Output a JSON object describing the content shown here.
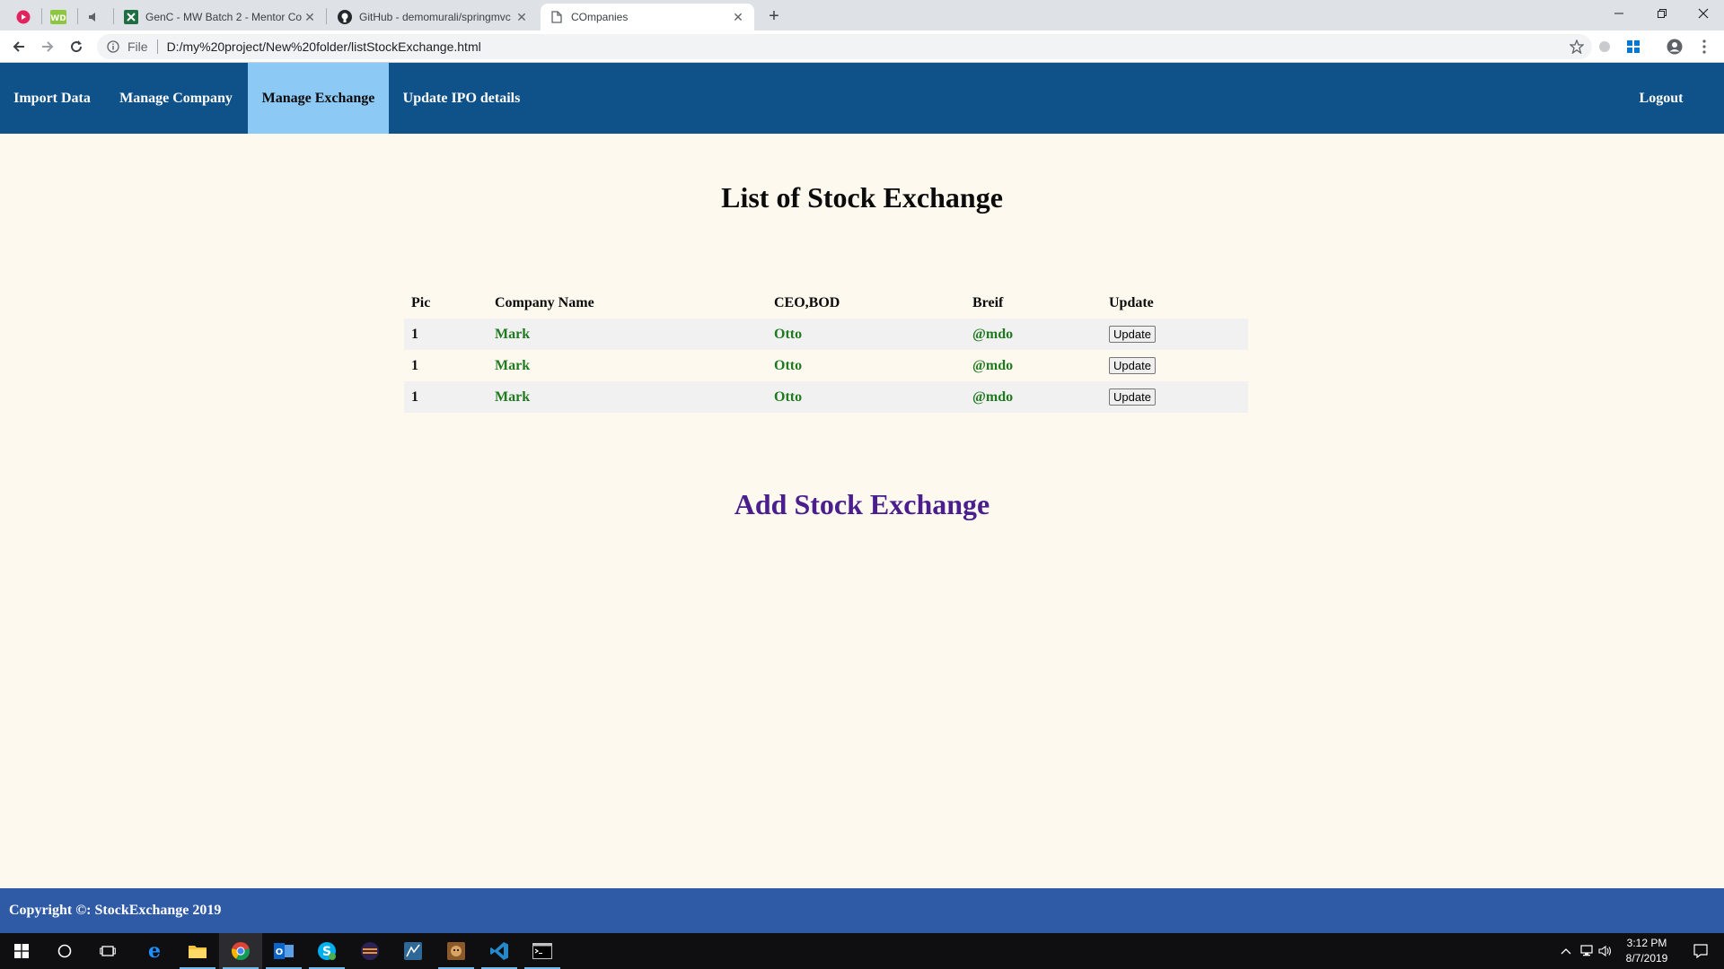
{
  "browser": {
    "tabs": [
      {
        "title": "GenC - MW Batch 2 - Mentor Co",
        "icon": "excel-icon"
      },
      {
        "title": "GitHub - demomurali/springmvc",
        "icon": "github-icon"
      },
      {
        "title": "COmpanies",
        "icon": "page-icon",
        "active": true
      }
    ],
    "address": {
      "scheme": "File",
      "url": "D:/my%20project/New%20folder/listStockExchange.html"
    }
  },
  "nav": {
    "items": [
      {
        "label": "Import Data"
      },
      {
        "label": "Manage Company"
      },
      {
        "label": "Manage Exchange",
        "active": true
      },
      {
        "label": "Update IPO details"
      }
    ],
    "logout_label": "Logout",
    "colors": {
      "bar": "#0f5289",
      "active": "#8cc9f4"
    }
  },
  "main": {
    "title": "List of Stock Exchange",
    "table": {
      "headers": [
        "Pic",
        "Company Name",
        "CEO,BOD",
        "Breif",
        "Update"
      ],
      "rows": [
        {
          "pic": "1",
          "company": "Mark",
          "ceo": "Otto",
          "brief": "@mdo",
          "button": "Update"
        },
        {
          "pic": "1",
          "company": "Mark",
          "ceo": "Otto",
          "brief": "@mdo",
          "button": "Update"
        },
        {
          "pic": "1",
          "company": "Mark",
          "ceo": "Otto",
          "brief": "@mdo",
          "button": "Update"
        }
      ]
    },
    "add_heading": "Add Stock Exchange"
  },
  "footer": {
    "text": "Copyright ©: StockExchange 2019",
    "color": "#2f5aa6"
  },
  "taskbar": {
    "apps": [
      "start-icon",
      "cortana-icon",
      "task-view-icon",
      "edge-icon",
      "file-explorer-icon",
      "chrome-icon",
      "outlook-icon",
      "skype-icon",
      "eclipse-icon",
      "mysql-workbench-icon",
      "tomcat-icon",
      "vscode-icon",
      "cmd-icon"
    ],
    "clock": {
      "time": "3:12 PM",
      "date": "8/7/2019"
    }
  }
}
